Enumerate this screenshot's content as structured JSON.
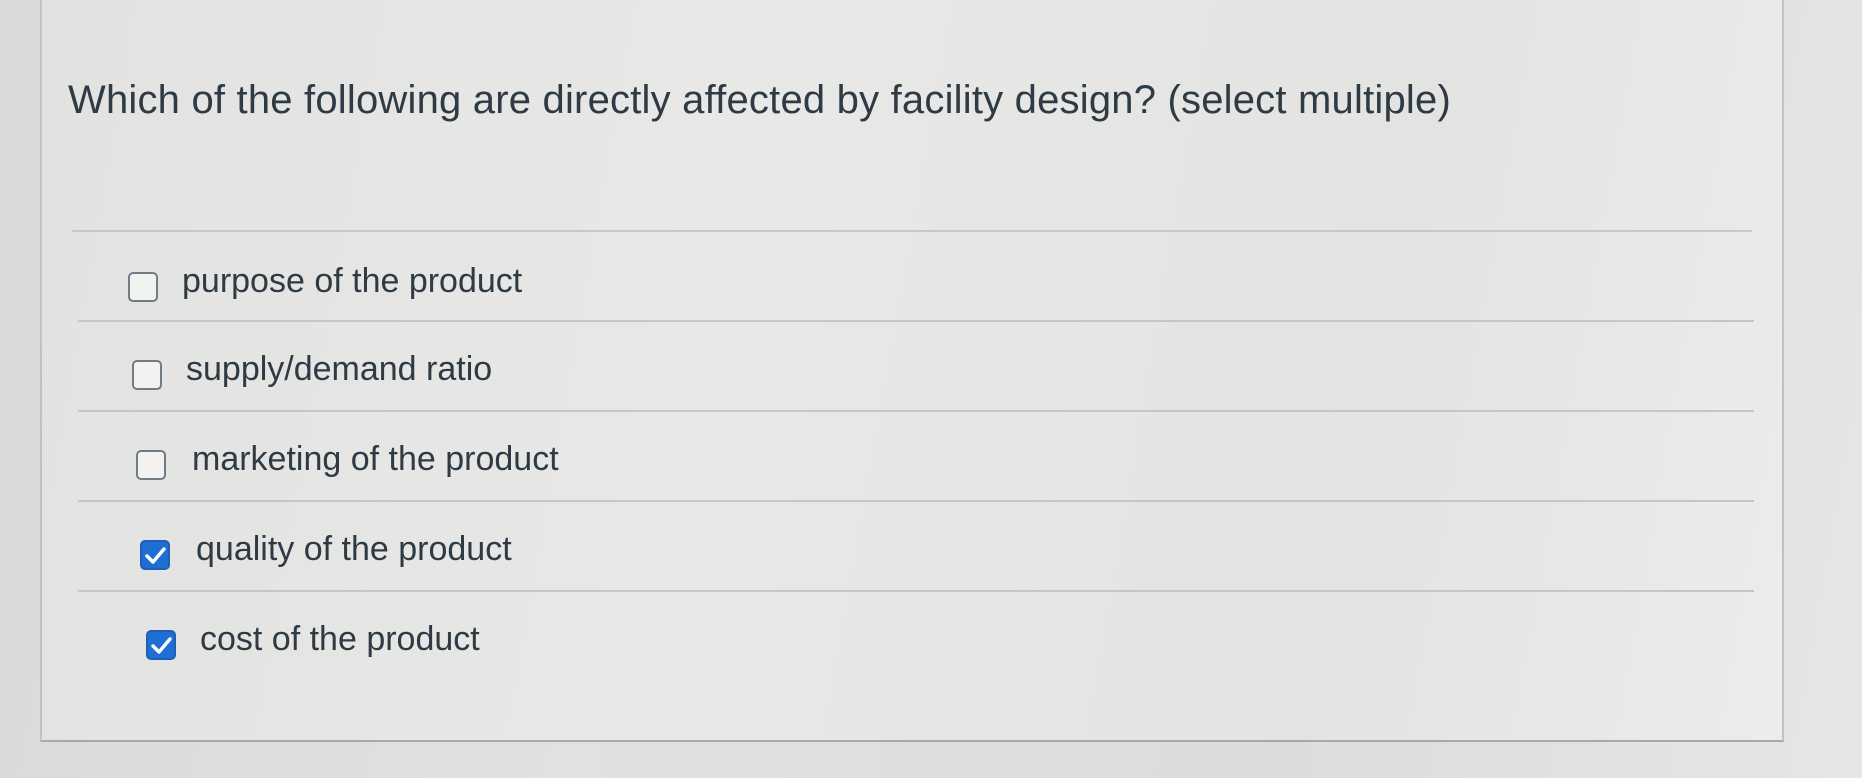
{
  "question": {
    "text": "Which of the following are directly affected by facility design? (select multiple)"
  },
  "answers": [
    {
      "label": "purpose of the product",
      "checked": false
    },
    {
      "label": "supply/demand ratio",
      "checked": false
    },
    {
      "label": "marketing of the product",
      "checked": false
    },
    {
      "label": "quality of the product",
      "checked": true
    },
    {
      "label": "cost of the product",
      "checked": true
    }
  ],
  "colors": {
    "checkbox_checked": "#1f6fd3",
    "text": "#2e3a44",
    "background": "#e4e4e2"
  },
  "icons": {
    "checked": "checkmark-icon"
  }
}
